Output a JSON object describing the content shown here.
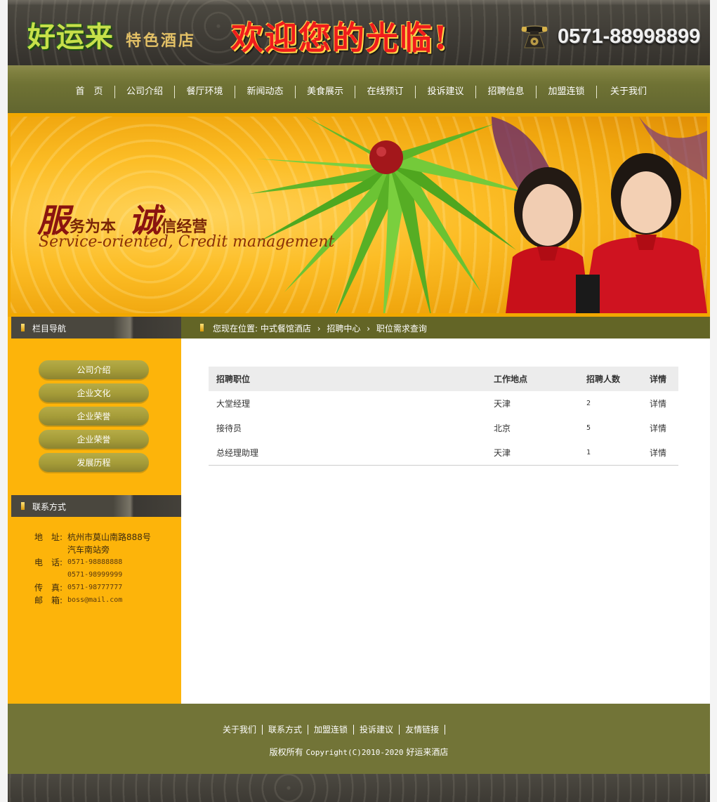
{
  "header": {
    "logo": "好运来",
    "logo_sub": "特色酒店",
    "welcome": "欢迎您的光临!",
    "phone": "0571-88998899",
    "phone_icon": "telephone-icon"
  },
  "nav": {
    "items": [
      "首　页",
      "公司介绍",
      "餐厅环境",
      "新闻动态",
      "美食展示",
      "在线预订",
      "投诉建议",
      "招聘信息",
      "加盟连锁",
      "关于我们"
    ]
  },
  "banner": {
    "slogan_big1": "服",
    "slogan_small1": "务为本",
    "slogan_big2": "诚",
    "slogan_small2": "信经营",
    "slogan_en": "Service-oriented, Credit management"
  },
  "sidebar": {
    "nav_title": "栏目导航",
    "buttons": [
      "公司介绍",
      "企业文化",
      "企业荣誉",
      "企业荣誉",
      "发展历程"
    ],
    "contact_title": "联系方式",
    "contact": {
      "address_label": "地　址:",
      "address_line1": "杭州市莫山南路888号",
      "address_line2": "汽车南站旁",
      "phone_label": "电　话:",
      "phone1": "0571-98888888",
      "phone2": "0571-98999999",
      "fax_label": "传　真:",
      "fax": "0571-98777777",
      "email_label": "邮　箱:",
      "email": "boss@mail.com"
    }
  },
  "breadcrumb": {
    "prefix": "您现在位置:",
    "items": [
      "中式餐馆酒店",
      "招聘中心",
      "职位需求查询"
    ]
  },
  "jobs": {
    "headers": [
      "招聘职位",
      "工作地点",
      "招聘人数",
      "详情"
    ],
    "rows": [
      {
        "title": "大堂经理",
        "location": "天津",
        "count": "2",
        "detail": "详情"
      },
      {
        "title": "接待员",
        "location": "北京",
        "count": "5",
        "detail": "详情"
      },
      {
        "title": "总经理助理",
        "location": "天津",
        "count": "1",
        "detail": "详情"
      }
    ]
  },
  "footer": {
    "links": [
      "关于我们",
      "联系方式",
      "加盟连锁",
      "投诉建议",
      "友情链接"
    ],
    "copyright_prefix": "版权所有",
    "copyright_mid": "Copyright(C)2010-2020",
    "copyright_suffix": "好运来酒店"
  },
  "colors": {
    "nav_bg": "#6f7234",
    "sidebar_bg": "#fdb40a",
    "footer_bg": "#727437",
    "welcome_red": "#ef1c1c"
  }
}
